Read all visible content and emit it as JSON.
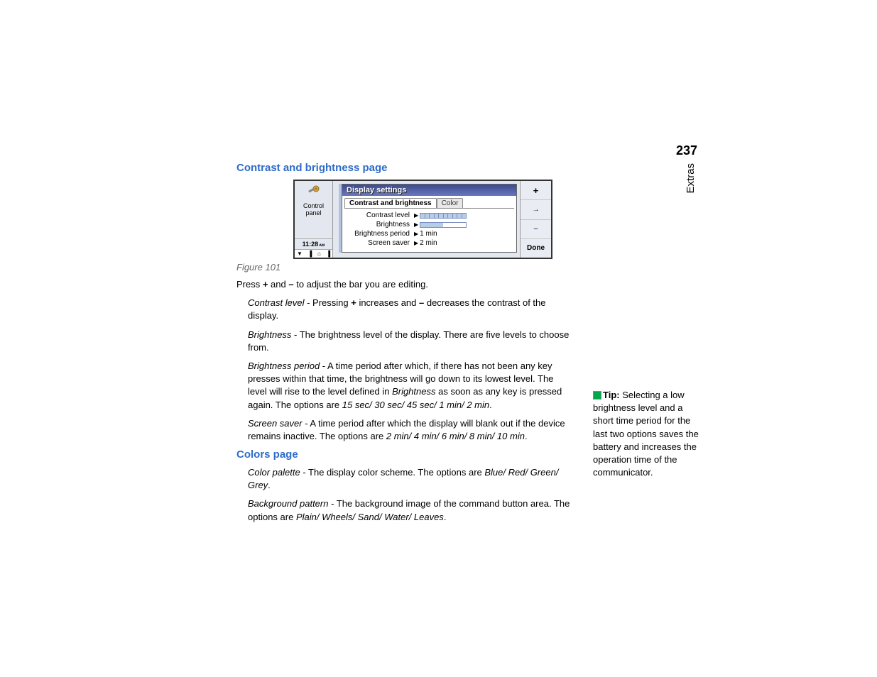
{
  "page_number": "237",
  "side_label": "Extras",
  "heading1": "Contrast and brightness page",
  "figure_caption": "Figure 101",
  "device": {
    "left_label": "Control panel",
    "time": "11:28",
    "time_suffix": " ᴀᴍ",
    "status_icons": [
      "▼",
      "▐",
      "⌂",
      "▐"
    ],
    "dialog_title": "Display settings",
    "tab_active": "Contrast and brightness",
    "tab_inactive": "Color",
    "rows": {
      "contrast_label": "Contrast level",
      "brightness_label": "Brightness",
      "bperiod_label": "Brightness period",
      "bperiod_value": "1 min",
      "ssaver_label": "Screen saver",
      "ssaver_value": "2 min"
    },
    "softkey_arrow": "→",
    "softkey_dash": "–",
    "softkey_done": "Done"
  },
  "press_line": {
    "a": "Press ",
    "plus": "+",
    "b": " and ",
    "minus": "–",
    "c": " to adjust the bar you are editing."
  },
  "item_contrast": {
    "name": "Contrast level",
    "a": " - Pressing ",
    "plus": "+",
    "b": " increases and ",
    "minus": "–",
    "c": " decreases the contrast of the display."
  },
  "item_brightness": {
    "name": "Brightness",
    "text": " - The brightness level of the display. There are five levels to choose from."
  },
  "item_bperiod": {
    "name": "Brightness period",
    "a": " - A time period after which, if there has not been any key presses within that time, the brightness will go down to its lowest level. The level will rise to the level defined in ",
    "ref": "Brightness",
    "b": " as soon as any key is pressed again. The options are ",
    "opts": "15 sec/ 30 sec/ 45 sec/ 1 min/ 2 min",
    "dot": "."
  },
  "item_ssaver": {
    "name": "Screen saver",
    "a": " - A time period after which the display will blank out if the device remains inactive. The options are ",
    "opts": "2 min/ 4 min/ 6 min/ 8 min/ 10 min",
    "dot": "."
  },
  "heading2": "Colors page",
  "item_cpalette": {
    "name": "Color palette",
    "a": " - The display color scheme. The options are ",
    "opts": "Blue/ Red/ Green/ Grey",
    "dot": "."
  },
  "item_bg": {
    "name": "Background pattern",
    "a": " - The background image of the command button area. The options are ",
    "opts": "Plain/ Wheels/ Sand/ Water/ Leaves",
    "dot": "."
  },
  "tip": {
    "label": "Tip:",
    "text": " Selecting a low brightness level and a short time period for the last two options saves the battery and increases the operation time of the communicator."
  }
}
